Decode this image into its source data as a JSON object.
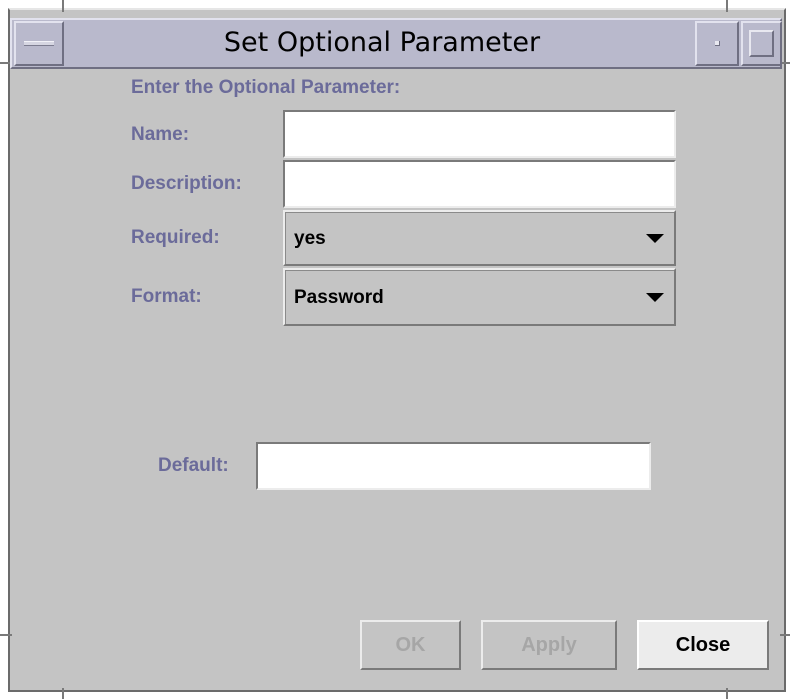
{
  "window": {
    "title": "Set Optional Parameter"
  },
  "form": {
    "heading": "Enter the Optional Parameter:",
    "name_label": "Name:",
    "name_value": "",
    "description_label": "Description:",
    "description_value": "",
    "required_label": "Required:",
    "required_value": "yes",
    "format_label": "Format:",
    "format_value": "Password",
    "default_label": "Default:",
    "default_value": ""
  },
  "buttons": {
    "ok_label": "OK",
    "apply_label": "Apply",
    "close_label": "Close"
  },
  "icons": {
    "window_menu": "window-menu-icon",
    "minimize": "minimize-icon",
    "maximize": "maximize-icon",
    "dropdown": "chevron-down-icon"
  }
}
